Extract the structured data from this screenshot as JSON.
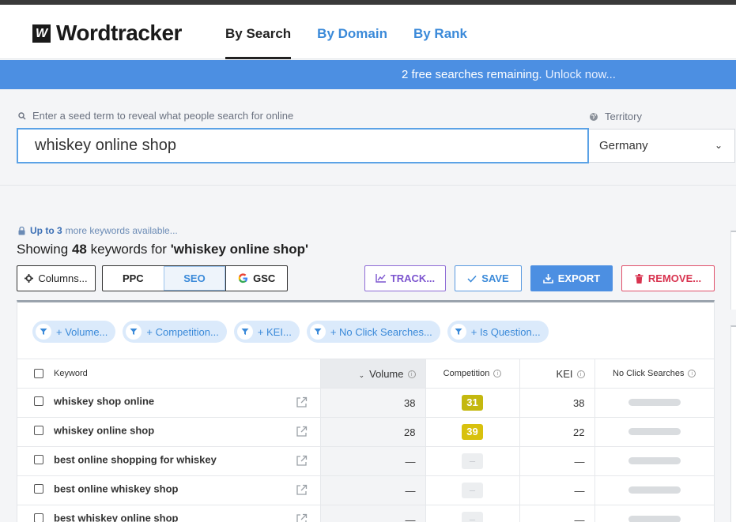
{
  "header": {
    "logo_mark": "W",
    "logo_text": "Wordtracker",
    "tabs": [
      "By Search",
      "By Domain",
      "By Rank"
    ]
  },
  "banner": {
    "text": "2 free searches remaining.",
    "link": "Unlock now..."
  },
  "search": {
    "label": "Enter a seed term to reveal what people search for online",
    "value": "whiskey online shop",
    "territory_label": "Territory",
    "territory_value": "Germany"
  },
  "results": {
    "up_to": "Up to 3",
    "more_available": "more keywords available...",
    "showing_prefix": "Showing",
    "count": "48",
    "showing_middle": "keywords for",
    "query": "'whiskey online shop'"
  },
  "toolbar": {
    "columns": "Columns...",
    "ppc": "PPC",
    "seo": "SEO",
    "gsc": "GSC",
    "track": "TRACK...",
    "save": "SAVE",
    "export": "EXPORT",
    "remove": "REMOVE..."
  },
  "filters": [
    "+ Volume...",
    "+ Competition...",
    "+ KEI...",
    "+ No Click Searches...",
    "+ Is Question..."
  ],
  "table": {
    "headers": {
      "keyword": "Keyword",
      "volume": "Volume",
      "competition": "Competition",
      "kei": "KEI",
      "no_click": "No Click Searches"
    },
    "rows": [
      {
        "keyword": "whiskey shop online",
        "volume": "38",
        "competition": "31",
        "kei": "38"
      },
      {
        "keyword": "whiskey online shop",
        "volume": "28",
        "competition": "39",
        "kei": "22"
      },
      {
        "keyword": "best online shopping for whiskey",
        "volume": "—",
        "competition": "–",
        "kei": "—"
      },
      {
        "keyword": "best online whiskey shop",
        "volume": "—",
        "competition": "–",
        "kei": "—"
      },
      {
        "keyword": "best whiskey online shop",
        "volume": "—",
        "competition": "–",
        "kei": "—"
      }
    ]
  },
  "colors": {
    "accent": "#4c8fe2",
    "competition_31": "#c4b80f",
    "competition_39": "#d8c10e",
    "track": "#7c55cf",
    "remove": "#d8334f"
  }
}
